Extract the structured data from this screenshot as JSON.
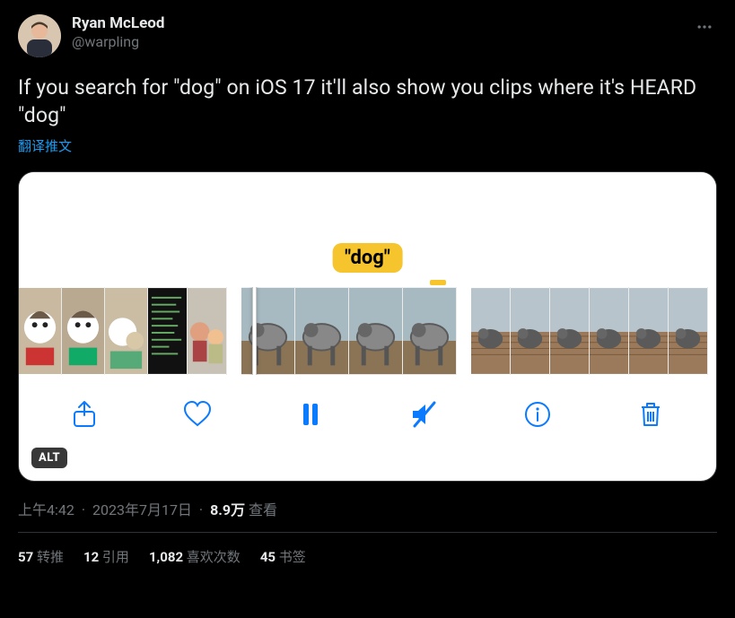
{
  "author": {
    "display_name": "Ryan McLeod",
    "handle": "@warpling"
  },
  "text": "If you search for \"dog\" on iOS 17 it'll also show you clips where it's HEARD \"dog\"",
  "translate_label": "翻译推文",
  "media": {
    "bubble_text": "\"dog\"",
    "alt_badge": "ALT"
  },
  "meta": {
    "time": "上午4:42",
    "date": "2023年7月17日",
    "views_count": "8.9万",
    "views_label": "查看"
  },
  "stats": {
    "retweets": {
      "count": "57",
      "label": "转推"
    },
    "quotes": {
      "count": "12",
      "label": "引用"
    },
    "likes": {
      "count": "1,082",
      "label": "喜欢次数"
    },
    "bookmarks": {
      "count": "45",
      "label": "书签"
    }
  },
  "icons": {
    "more": "more-icon",
    "share": "share-icon",
    "heart": "heart-icon",
    "pause": "pause-icon",
    "mute": "mute-icon",
    "info": "info-icon",
    "trash": "trash-icon"
  }
}
